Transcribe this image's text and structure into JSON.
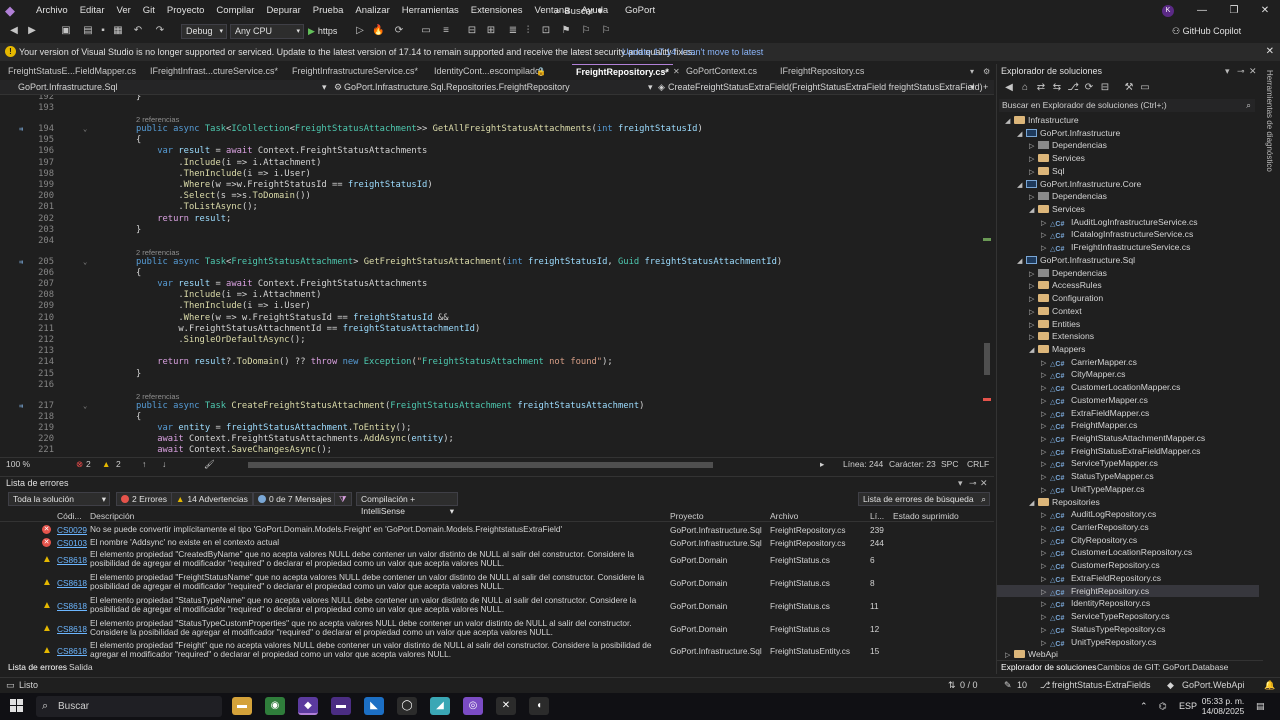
{
  "menu": {
    "items": [
      "Archivo",
      "Editar",
      "Ver",
      "Git",
      "Proyecto",
      "Compilar",
      "Depurar",
      "Prueba",
      "Analizar",
      "Herramientas",
      "Extensiones",
      "Ventana",
      "Ayuda"
    ],
    "search_label": "Buscar",
    "project_name": "GoPort",
    "avatar_initial": "K"
  },
  "toolbar": {
    "config": "Debug",
    "platform": "Any CPU",
    "run_label": "https",
    "copilot_label": "GitHub Copilot"
  },
  "infobar": {
    "message": "Your version of Visual Studio is no longer supported or serviced. Update to the latest version of 17.14 to remain supported and receive the latest security and quality fixes.",
    "update_link": "Update 17.14",
    "dismiss_link": "I can't move to latest"
  },
  "tabs": [
    {
      "label": "FreightStatusE...FieldMapper.cs"
    },
    {
      "label": "IFreightInfrast...ctureService.cs*"
    },
    {
      "label": "FreightInfrastructureService.cs*"
    },
    {
      "label": "IdentityCont...escompilado]"
    },
    {
      "label": "FreightRepository.cs*"
    },
    {
      "label": "GoPortContext.cs"
    },
    {
      "label": "IFreightRepository.cs"
    }
  ],
  "navbar": {
    "project": "GoPort.Infrastructure.Sql",
    "class": "GoPort.Infrastructure.Sql.Repositories.FreightRepository",
    "member": "CreateFreightStatusExtraField(FreightStatusExtraField freightStatusExtraField)"
  },
  "code": {
    "refs": "2 referencias",
    "lines": [
      {
        "n": "192",
        "t": "}"
      },
      {
        "n": "193",
        "t": ""
      },
      {
        "n": "194",
        "t": "public async Task<ICollection<FreightStatusAttachment>> GetAllFreightStatusAttachments(int freightStatusId)"
      },
      {
        "n": "195",
        "t": "{"
      },
      {
        "n": "196",
        "t": "    var result = await Context.FreightStatusAttachments"
      },
      {
        "n": "197",
        "t": "        .Include(i => i.Attachment)"
      },
      {
        "n": "198",
        "t": "        .ThenInclude(i => i.User)"
      },
      {
        "n": "199",
        "t": "        .Where(w =>w.FreightStatusId == freightStatusId)"
      },
      {
        "n": "200",
        "t": "        .Select(s =>s.ToDomain())"
      },
      {
        "n": "201",
        "t": "        .ToListAsync();"
      },
      {
        "n": "202",
        "t": "    return result;"
      },
      {
        "n": "203",
        "t": "}"
      },
      {
        "n": "204",
        "t": ""
      },
      {
        "n": "205",
        "t": "public async Task<FreightStatusAttachment> GetFreightStatusAttachment(int freightStatusId, Guid freightStatusAttachmentId)"
      },
      {
        "n": "206",
        "t": "{"
      },
      {
        "n": "207",
        "t": "    var result = await Context.FreightStatusAttachments"
      },
      {
        "n": "208",
        "t": "        .Include(i => i.Attachment)"
      },
      {
        "n": "209",
        "t": "        .ThenInclude(i => i.User)"
      },
      {
        "n": "210",
        "t": "        .Where(w => w.FreightStatusId == freightStatusId &&"
      },
      {
        "n": "211",
        "t": "        w.FreightStatusAttachmentId == freightStatusAttachmentId)"
      },
      {
        "n": "212",
        "t": "        .SingleOrDefaultAsync();"
      },
      {
        "n": "213",
        "t": ""
      },
      {
        "n": "214",
        "t": "    return result?.ToDomain() ?? throw new Exception(\"FreightStatusAttachment not found\");"
      },
      {
        "n": "215",
        "t": "}"
      },
      {
        "n": "216",
        "t": ""
      },
      {
        "n": "217",
        "t": "public async Task CreateFreightStatusAttachment(FreightStatusAttachment freightStatusAttachment)"
      },
      {
        "n": "218",
        "t": "{"
      },
      {
        "n": "219",
        "t": "    var entity = freightStatusAttachment.ToEntity();"
      },
      {
        "n": "220",
        "t": "    await Context.FreightStatusAttachments.AddAsync(entity);"
      },
      {
        "n": "221",
        "t": "    await Context.SaveChangesAsync();"
      }
    ]
  },
  "editor_status": {
    "zoom": "100 %",
    "errors": "2",
    "warnings": "2",
    "line": "Línea: 244",
    "col": "Carácter: 23",
    "spc": "SPC",
    "eol": "CRLF"
  },
  "error_list": {
    "title": "Lista de errores",
    "scope": "Toda la solución",
    "errors_btn": "2 Errores",
    "warnings_btn": "14 Advertencias",
    "messages_btn": "0 de 7 Mensajes",
    "build_filter": "Compilación + IntelliSense",
    "search_placeholder": "Lista de errores de búsqueda",
    "headers": {
      "code": "Códi...",
      "desc": "Descripción",
      "proj": "Proyecto",
      "file": "Archivo",
      "line": "Lí...",
      "state": "Estado suprimido"
    },
    "rows": [
      {
        "kind": "e",
        "code": "CS0029",
        "desc": "No se puede convertir implícitamente el tipo 'GoPort.Domain.Models.Freight' en 'GoPort.Domain.Models.FreightstatusExtraField'",
        "proj": "GoPort.Infrastructure.Sql",
        "file": "FreightRepository.cs",
        "line": "239"
      },
      {
        "kind": "e",
        "code": "CS0103",
        "desc": "El nombre 'Addsync' no existe en el contexto actual",
        "proj": "GoPort.Infrastructure.Sql",
        "file": "FreightRepository.cs",
        "line": "244"
      },
      {
        "kind": "w",
        "code": "CS8618",
        "desc": "El elemento propiedad \"CreatedByName\" que no acepta valores NULL debe contener un valor distinto de NULL al salir del constructor. Considere la posibilidad de agregar el modificador \"required\" o declarar el propiedad como un valor que acepta valores NULL.",
        "proj": "GoPort.Domain",
        "file": "FreightStatus.cs",
        "line": "6"
      },
      {
        "kind": "w",
        "code": "CS8618",
        "desc": "El elemento propiedad \"FreightStatusName\" que no acepta valores NULL debe contener un valor distinto de NULL al salir del constructor. Considere la posibilidad de agregar el modificador \"required\" o declarar el propiedad como un valor que acepta valores NULL.",
        "proj": "GoPort.Domain",
        "file": "FreightStatus.cs",
        "line": "8"
      },
      {
        "kind": "w",
        "code": "CS8618",
        "desc": "El elemento propiedad \"StatusTypeName\" que no acepta valores NULL debe contener un valor distinto de NULL al salir del constructor. Considere la posibilidad de agregar el modificador \"required\" o declarar el propiedad como un valor que acepta valores NULL.",
        "proj": "GoPort.Domain",
        "file": "FreightStatus.cs",
        "line": "11"
      },
      {
        "kind": "w",
        "code": "CS8618",
        "desc": "El elemento propiedad \"StatusTypeCustomProperties\" que no acepta valores NULL debe contener un valor distinto de NULL al salir del constructor. Considere la posibilidad de agregar el modificador \"required\" o declarar el propiedad como un valor que acepta valores NULL.",
        "proj": "GoPort.Domain",
        "file": "FreightStatus.cs",
        "line": "12"
      },
      {
        "kind": "w",
        "code": "CS8618",
        "desc": "El elemento propiedad \"Freight\" que no acepta valores NULL debe contener un valor distinto de NULL al salir del constructor. Considere la posibilidad de agregar el modificador \"required\" o declarar el propiedad como un valor que acepta valores NULL.",
        "proj": "GoPort.Infrastructure.Sql",
        "file": "FreightStatusEntity.cs",
        "line": "15"
      }
    ],
    "bottom_tabs": [
      "Lista de errores",
      "Salida"
    ]
  },
  "solution": {
    "title": "Explorador de soluciones",
    "search_placeholder": "Buscar en Explorador de soluciones (Ctrl+;)",
    "nodes": [
      {
        "label": "Infrastructure",
        "type": "folder",
        "lvl": 0
      },
      {
        "label": "GoPort.Infrastructure",
        "type": "proj",
        "lvl": 1
      },
      {
        "label": "Dependencias",
        "type": "dep",
        "lvl": 2
      },
      {
        "label": "Services",
        "type": "folder",
        "lvl": 2
      },
      {
        "label": "Sql",
        "type": "folder",
        "lvl": 2
      },
      {
        "label": "GoPort.Infrastructure.Core",
        "type": "proj",
        "lvl": 1
      },
      {
        "label": "Dependencias",
        "type": "dep",
        "lvl": 2
      },
      {
        "label": "Services",
        "type": "folder",
        "lvl": 2
      },
      {
        "label": "IAuditLogInfrastructureService.cs",
        "type": "cs",
        "lvl": 3
      },
      {
        "label": "ICatalogInfrastructureService.cs",
        "type": "cs",
        "lvl": 3
      },
      {
        "label": "IFreightInfrastructureService.cs",
        "type": "cs",
        "lvl": 3
      },
      {
        "label": "GoPort.Infrastructure.Sql",
        "type": "proj",
        "lvl": 1
      },
      {
        "label": "Dependencias",
        "type": "dep",
        "lvl": 2
      },
      {
        "label": "AccessRules",
        "type": "folder",
        "lvl": 2
      },
      {
        "label": "Configuration",
        "type": "folder",
        "lvl": 2
      },
      {
        "label": "Context",
        "type": "folder",
        "lvl": 2
      },
      {
        "label": "Entities",
        "type": "folder",
        "lvl": 2
      },
      {
        "label": "Extensions",
        "type": "folder",
        "lvl": 2
      },
      {
        "label": "Mappers",
        "type": "folder",
        "lvl": 2
      },
      {
        "label": "CarrierMapper.cs",
        "type": "cs",
        "lvl": 3
      },
      {
        "label": "CityMapper.cs",
        "type": "cs",
        "lvl": 3
      },
      {
        "label": "CustomerLocationMapper.cs",
        "type": "cs",
        "lvl": 3
      },
      {
        "label": "CustomerMapper.cs",
        "type": "cs",
        "lvl": 3
      },
      {
        "label": "ExtraFieldMapper.cs",
        "type": "cs",
        "lvl": 3
      },
      {
        "label": "FreightMapper.cs",
        "type": "cs",
        "lvl": 3
      },
      {
        "label": "FreightStatusAttachmentMapper.cs",
        "type": "cs",
        "lvl": 3
      },
      {
        "label": "FreightStatusExtraFieldMapper.cs",
        "type": "cs",
        "lvl": 3
      },
      {
        "label": "ServiceTypeMapper.cs",
        "type": "cs",
        "lvl": 3
      },
      {
        "label": "StatusTypeMapper.cs",
        "type": "cs",
        "lvl": 3
      },
      {
        "label": "UnitTypeMapper.cs",
        "type": "cs",
        "lvl": 3
      },
      {
        "label": "Repositories",
        "type": "folder",
        "lvl": 2
      },
      {
        "label": "AuditLogRepository.cs",
        "type": "cs",
        "lvl": 3
      },
      {
        "label": "CarrierRepository.cs",
        "type": "cs",
        "lvl": 3
      },
      {
        "label": "CityRepository.cs",
        "type": "cs",
        "lvl": 3
      },
      {
        "label": "CustomerLocationRepository.cs",
        "type": "cs",
        "lvl": 3
      },
      {
        "label": "CustomerRepository.cs",
        "type": "cs",
        "lvl": 3
      },
      {
        "label": "ExtraFieldRepository.cs",
        "type": "cs",
        "lvl": 3
      },
      {
        "label": "FreightRepository.cs",
        "type": "cs",
        "lvl": 3
      },
      {
        "label": "IdentityRepository.cs",
        "type": "cs",
        "lvl": 3
      },
      {
        "label": "ServiceTypeRepository.cs",
        "type": "cs",
        "lvl": 3
      },
      {
        "label": "StatusTypeRepository.cs",
        "type": "cs",
        "lvl": 3
      },
      {
        "label": "UnitTypeRepository.cs",
        "type": "cs",
        "lvl": 3
      },
      {
        "label": "WebApi",
        "type": "folder",
        "lvl": 0
      }
    ],
    "bottom_tabs": [
      "Explorador de soluciones",
      "Cambios de GIT: GoPort.Database"
    ],
    "side_label": "Herramientas de diagnóstico"
  },
  "statusbar": {
    "ready": "Listo",
    "pending": "0 / 0",
    "commits": "10",
    "branch": "freightStatus-ExtraFields",
    "project": "GoPort.WebApi"
  },
  "taskbar": {
    "search": "Buscar",
    "lang": "ESP",
    "time": "05:33 p. m.",
    "date": "14/08/2025"
  }
}
